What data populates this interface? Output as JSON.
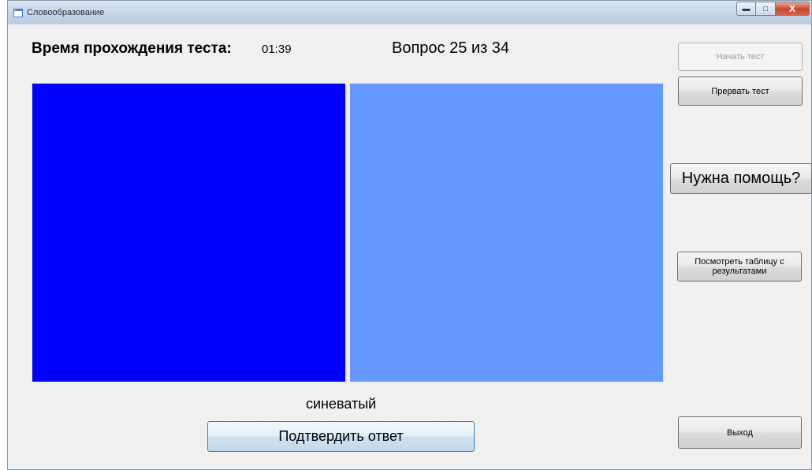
{
  "window": {
    "title": "Словообразование",
    "caption_buttons": {
      "minimize": "▬",
      "maximize": "□",
      "close": "X"
    }
  },
  "test": {
    "timer_label": "Время прохождения теста:",
    "timer_value": "01:39",
    "question_counter": "Вопрос 25 из 34",
    "word": "синеватый"
  },
  "swatches": {
    "left_color": "#0000ff",
    "right_color": "#6699ff"
  },
  "buttons": {
    "start_test": "Начать тест",
    "abort_test": "Прервать тест",
    "help": "Нужна помощь?",
    "results_table": "Посмотреть таблицу с результатами",
    "confirm_answer": "Подтвердить ответ",
    "exit": "Выход"
  },
  "icons": {
    "app": "app-window-icon"
  }
}
